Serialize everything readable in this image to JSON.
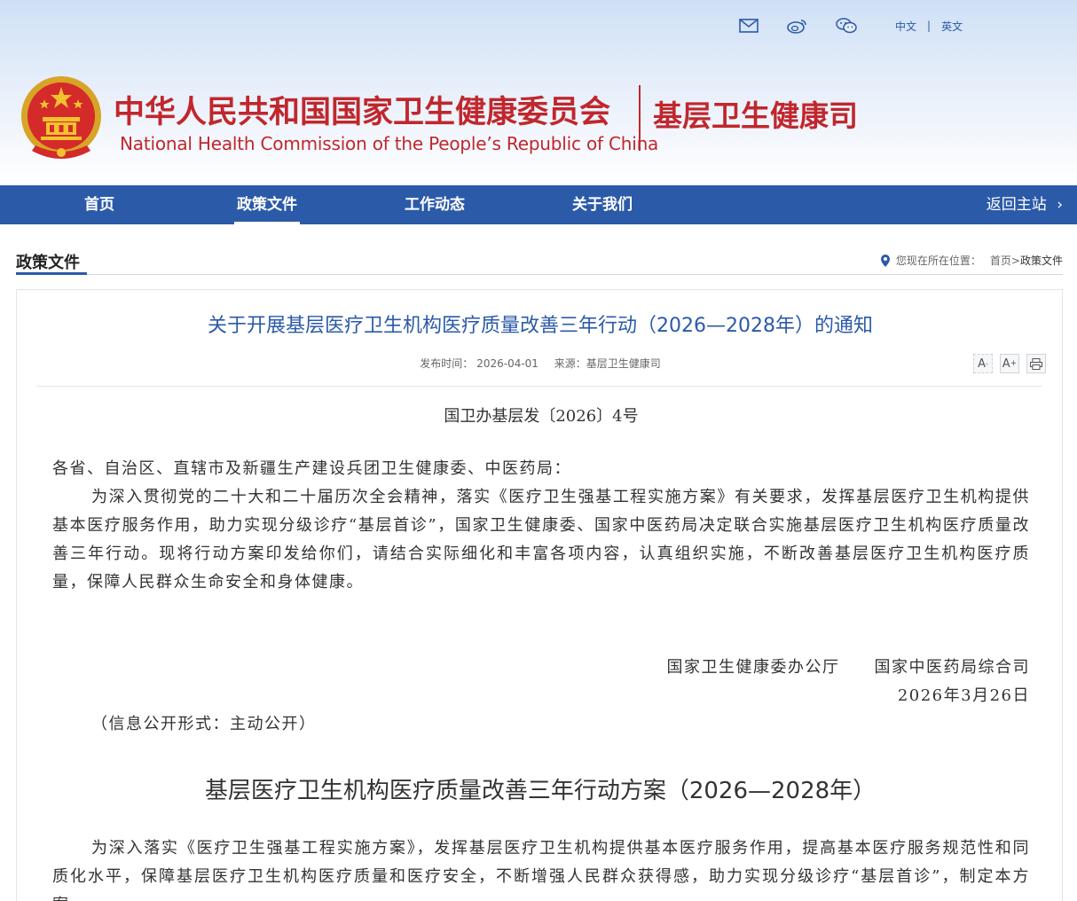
{
  "toplinks": {
    "icons": [
      "mail-icon",
      "weibo-icon",
      "wechat-icon"
    ],
    "lang_cn": "中文",
    "sep": "|",
    "lang_en": "英文"
  },
  "header": {
    "title_cn": "中华人民共和国国家卫生健康委员会",
    "title_en": "National Health Commission of the People’s  Republic of China",
    "dept": "基层卫生健康司"
  },
  "nav": {
    "items": [
      {
        "label": "首页"
      },
      {
        "label": "政策文件"
      },
      {
        "label": "工作动态"
      },
      {
        "label": "关于我们"
      }
    ],
    "back": "返回主站",
    "active_index": 1
  },
  "section": {
    "title": "政策文件",
    "location_prefix": "您现在所在位置：",
    "crumb_home": "首页",
    "crumb_sep": ">",
    "crumb_current": "政策文件"
  },
  "article": {
    "title": "关于开展基层医疗卫生机构医疗质量改善三年行动（2026—2028年）的通知",
    "publish_label": "发布时间：",
    "publish_date": "2026-04-01",
    "source_label": "来源：",
    "source": "基层卫生健康司",
    "tools": [
      "A-",
      "A+",
      "print"
    ],
    "doc_no": "国卫办基层发〔2026〕4号",
    "salutation": "各省、自治区、直辖市及新疆生产建设兵团卫生健康委、中医药局：",
    "para1": "为深入贯彻党的二十大和二十届历次全会精神，落实《医疗卫生强基工程实施方案》有关要求，发挥基层医疗卫生机构提供基本医疗服务作用，助力实现分级诊疗“基层首诊”，国家卫生健康委、国家中医药局决定联合实施基层医疗卫生机构医疗质量改善三年行动。现将行动方案印发给你们，请结合实际细化和丰富各项内容，认真组织实施，不断改善基层医疗卫生机构医疗质量，保障人民群众生命安全和身体健康。",
    "signers": "国家卫生健康委办公厅　　国家中医药局综合司",
    "sign_date": "2026年3月26日",
    "disclosure": "（信息公开形式：主动公开）",
    "subhead": "基层医疗卫生机构医疗质量改善三年行动方案（2026—2028年）",
    "para2": "为深入落实《医疗卫生强基工程实施方案》，发挥基层医疗卫生机构提供基本医疗服务作用，提高基本医疗服务规范性和同质化水平，保障基层医疗卫生机构医疗质量和医疗安全，不断增强人民群众获得感，助力实现分级诊疗“基层首诊”，制定本方案。"
  },
  "colors": {
    "brand_red": "#c0272d",
    "nav_blue": "#2b5aa8"
  }
}
